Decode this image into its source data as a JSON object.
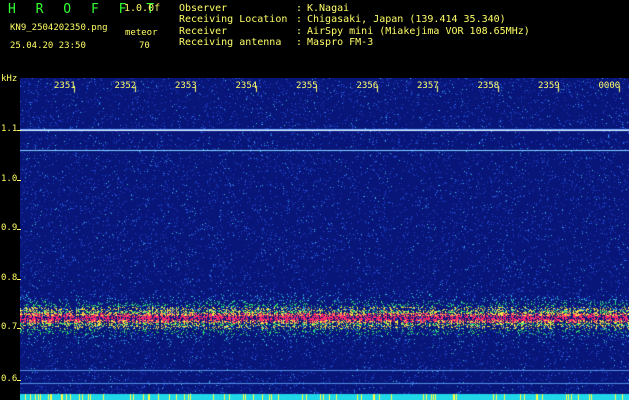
{
  "header": {
    "logo": "H R O F F T",
    "version": "1.0.0f",
    "filename": "KN9_2504202350.png",
    "mode": "meteor",
    "datetime": "25.04.20 23:50",
    "count": "70",
    "info": [
      {
        "label": "Observer",
        "value": "K.Nagai"
      },
      {
        "label": "Receiving Location",
        "value": "Chigasaki, Japan (139.414 35.340)"
      },
      {
        "label": "Receiver",
        "value": "AirSpy mini (Miakejima VOR 108.65MHz)"
      },
      {
        "label": "Receiving antenna",
        "value": "Maspro FM-3"
      }
    ]
  },
  "spectrogram": {
    "y_unit": "kHz",
    "y_ticks": [
      "1.1",
      "1.0",
      "0.9",
      "0.8",
      "0.7",
      "0.6"
    ],
    "time_labels": [
      "2351",
      "2352",
      "2353",
      "2354",
      "2355",
      "2356",
      "2357",
      "2358",
      "2359",
      "0000"
    ],
    "colors": {
      "background": "#0a1a8a",
      "noise": "#2a5fe0",
      "signal_mid": "#2fd0d0",
      "signal_high": "#ff2a6a",
      "label": "#ffff66"
    }
  }
}
